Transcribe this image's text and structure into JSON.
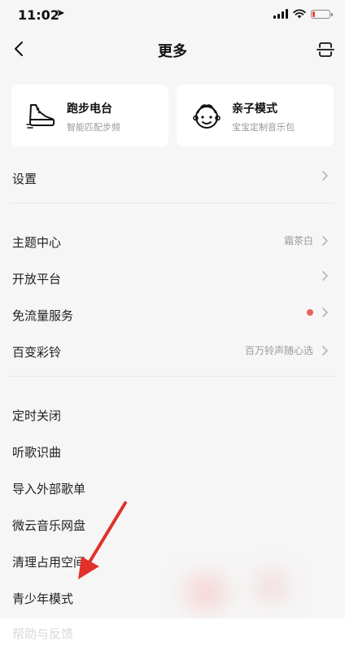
{
  "status": {
    "time": "11:02",
    "location_glyph": "➤",
    "battery_percent": 18
  },
  "nav": {
    "title": "更多",
    "back_icon": "chevron-left-icon",
    "scan_icon": "scan-icon"
  },
  "cards": [
    {
      "title": "跑步电台",
      "subtitle": "智能匹配步频",
      "icon": "running-shoe-icon"
    },
    {
      "title": "亲子模式",
      "subtitle": "宝宝定制音乐包",
      "icon": "baby-face-icon"
    }
  ],
  "list": {
    "settings": {
      "label": "设置"
    },
    "theme": {
      "label": "主题中心",
      "value": "霜茶白"
    },
    "open_platform": {
      "label": "开放平台"
    },
    "free_traffic": {
      "label": "免流量服务"
    },
    "ringtone": {
      "label": "百变彩铃",
      "value": "百万铃声随心选"
    },
    "timer_off": {
      "label": "定时关闭"
    },
    "song_recognition": {
      "label": "听歌识曲"
    },
    "import_playlist": {
      "label": "导入外部歌单"
    },
    "cloud_disk": {
      "label": "微云音乐网盘"
    },
    "clear_space": {
      "label": "清理占用空间"
    },
    "youth_mode": {
      "label": "青少年模式"
    },
    "help": {
      "label": "帮助与反馈"
    }
  },
  "colors": {
    "accent_red": "#e8615c",
    "arrow_red": "#e0322b",
    "background": "#f6f6f6"
  }
}
